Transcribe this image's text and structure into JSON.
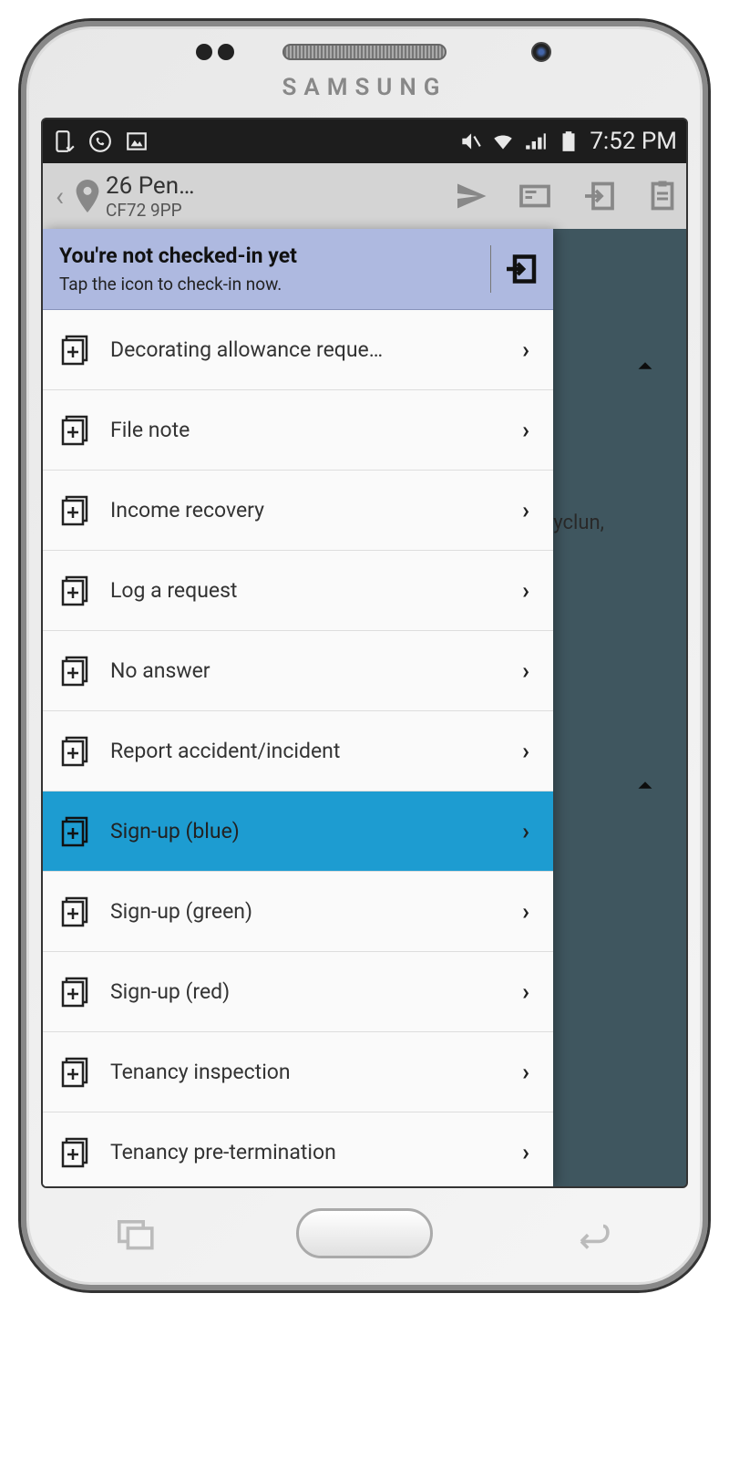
{
  "brand": "SAMSUNG",
  "status_bar": {
    "time": "7:52 PM"
  },
  "header": {
    "title": "26 Pen…",
    "subtitle": "CF72 9PP"
  },
  "checkin": {
    "title": "You're not checked-in yet",
    "subtitle": "Tap the icon to check-in now."
  },
  "background": {
    "partial_text": "yclun,"
  },
  "menu_items": [
    {
      "label": "Decorating allowance reque…",
      "selected": false
    },
    {
      "label": "File note",
      "selected": false
    },
    {
      "label": "Income recovery",
      "selected": false
    },
    {
      "label": "Log a request",
      "selected": false
    },
    {
      "label": "No answer",
      "selected": false
    },
    {
      "label": "Report accident/incident",
      "selected": false
    },
    {
      "label": "Sign-up (blue)",
      "selected": true
    },
    {
      "label": "Sign-up (green)",
      "selected": false
    },
    {
      "label": "Sign-up (red)",
      "selected": false
    },
    {
      "label": "Tenancy inspection",
      "selected": false
    },
    {
      "label": "Tenancy pre-termination",
      "selected": false
    }
  ]
}
